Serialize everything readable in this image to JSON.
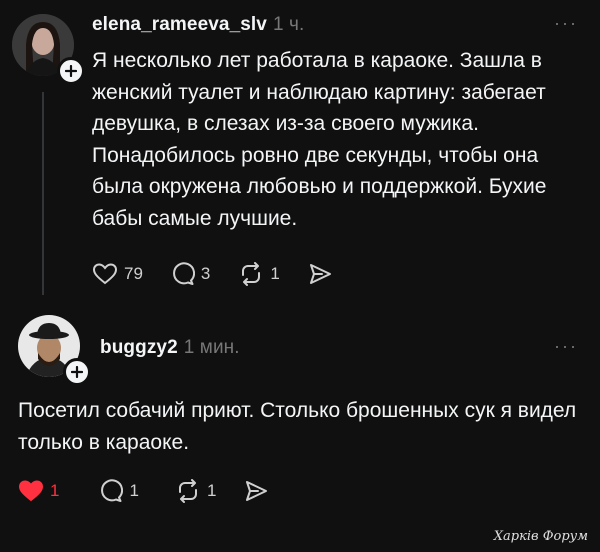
{
  "posts": [
    {
      "username": "elena_rameeva_slv",
      "time": "1 ч.",
      "text": "Я несколько лет работала в караоке. Зашла в женский туалет и наблюдаю картину: забегает девушка, в слезах из-за своего мужика. Понадобилось ровно две секунды, чтобы она была окружена любовью и поддержкой. Бухие бабы самые лучшие.",
      "likes": "79",
      "replies": "3",
      "reposts": "1",
      "liked": false
    },
    {
      "username": "buggzy2",
      "time": "1 мин.",
      "text": "Посетил собачий приют. Столько брошенных сук я видел только в караоке.",
      "likes": "1",
      "replies": "1",
      "reposts": "1",
      "liked": true
    }
  ],
  "more_label": "···",
  "watermark": "Харків Форум",
  "colors": {
    "background": "#101010",
    "text": "#f3f5f7",
    "muted": "#777777",
    "like_active": "#ff3040"
  },
  "icons": [
    "plus-icon",
    "heart-icon",
    "reply-icon",
    "repost-icon",
    "share-icon",
    "more-icon"
  ]
}
